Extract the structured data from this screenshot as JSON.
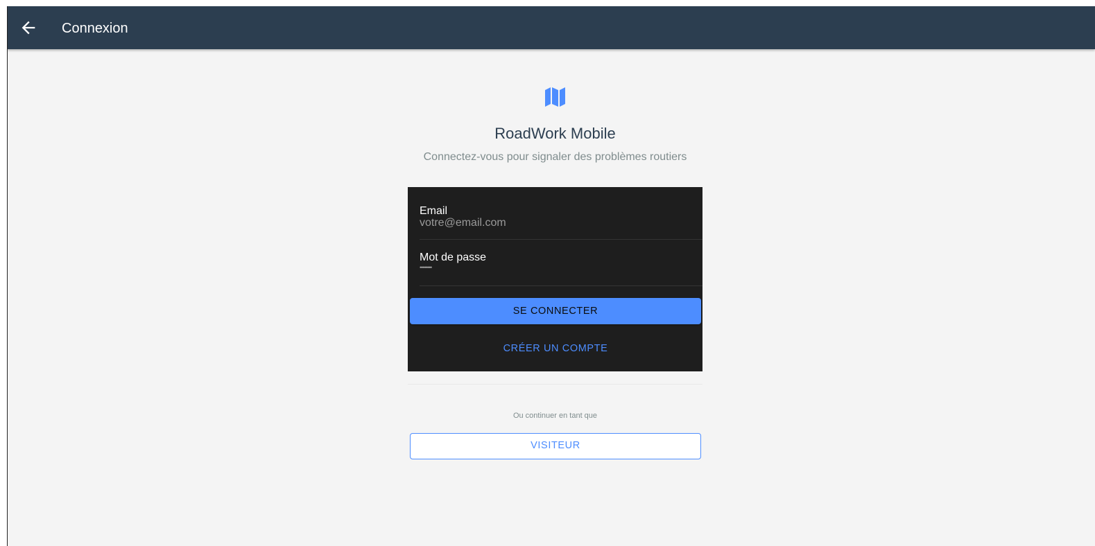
{
  "toolbar": {
    "title": "Connexion",
    "back_icon": "arrow-left-icon",
    "background": "#2c3e50"
  },
  "branding": {
    "logo_icon": "map-icon",
    "app_name": "RoadWork Mobile",
    "subtitle": "Connectez-vous pour signaler des problèmes routiers",
    "accent": "#4d8dff"
  },
  "login_form": {
    "email": {
      "label": "Email",
      "placeholder": "votre@email.com",
      "value": ""
    },
    "password": {
      "label": "Mot de passe",
      "placeholder": "••••••••",
      "value": ""
    },
    "submit_label": "SE CONNECTER",
    "register_label": "CRÉER UN COMPTE"
  },
  "guest": {
    "hint": "Ou continuer en tant que",
    "button_label": "VISITEUR"
  }
}
